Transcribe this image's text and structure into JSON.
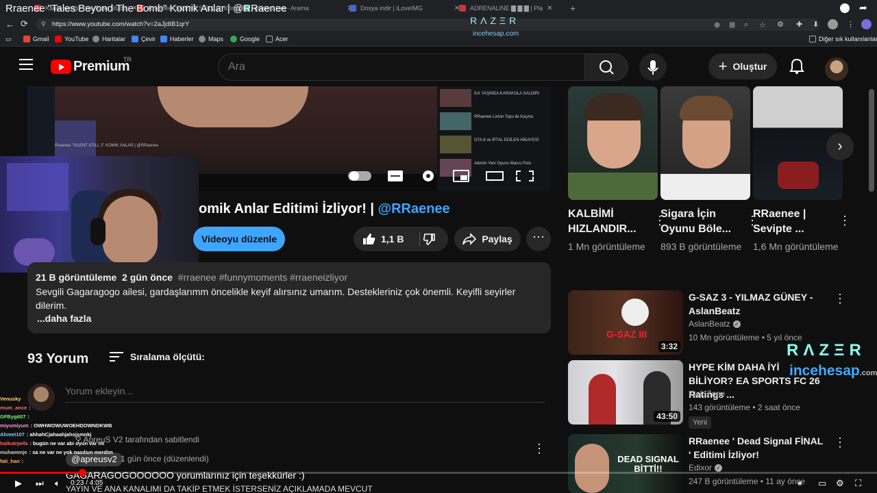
{
  "window": {
    "title": "Rraenee \"Tales Beyond The Bomb\" Komik Anlar | @RRaenee"
  },
  "tabs": [
    {
      "label": "Kanal içeriği - YouTube Studio"
    },
    {
      "label": "Rraenee \"SILENT STILL 2\" Komik"
    },
    {
      "label": "görüntü net - Arama"
    },
    {
      "label": "Dosya indir | iLoveIMG"
    },
    {
      "label": "ADRENALINE ▇ ▇ ▇ | Pla"
    }
  ],
  "address": {
    "url": "https://www.youtube.com/watch?v=2aJjdIB1qrY"
  },
  "bookmarks": [
    {
      "label": "Gmail",
      "color": "#ea4335"
    },
    {
      "label": "YouTube",
      "color": "#ff0000"
    },
    {
      "label": "Haritalar",
      "color": "#888888"
    },
    {
      "label": "Çevir",
      "color": "#4285f4"
    },
    {
      "label": "Haberler",
      "color": "#4285f4"
    },
    {
      "label": "Maps",
      "color": "#888888"
    },
    {
      "label": "Google",
      "color": "#34a853"
    },
    {
      "label": "Acer",
      "color": "#888888"
    }
  ],
  "bookmarks_other": "Diğer sık kullanılanlar",
  "header": {
    "logo_text": "Premium",
    "logo_region": "TR",
    "search_placeholder": "Ara",
    "create_label": "Oluştur"
  },
  "embedded_player": {
    "razer": "RΛZΞR",
    "incehesap": "incehesap.com",
    "caption": "Rraenee \"SILENT STILL 2\" KOMİK ANLAR | @RRaenee",
    "side_items": [
      "İLK YAŞINDA KARAKOLA SALDIRI",
      "RRaenee Linton Topu ile Kaçma",
      "GTA 6 ve İPTAL EDİLEN HİKAYESİ",
      "Adenin Yeni Oyunu Marco Polo"
    ]
  },
  "video": {
    "title_text": "omik Anlar Editimi İzliyor! | ",
    "title_handle": "@RRaenee",
    "edit_label": "Videoyu düzenle",
    "like_count": "1,1 B",
    "share_label": "Paylaş"
  },
  "description": {
    "views": "21 B görüntüleme",
    "date": "2 gün önce",
    "tags": "#rraenee #funnymoments #rraeneizliyor",
    "body": "Sevgili Gagaragogo ailesi, gardaşlarımm öncelikle keyif alırsınız umarım. Destekleriniz çok önemli. Keyifli seyirler dilerim.",
    "more": "...daha fazla"
  },
  "comments": {
    "count": "93 Yorum",
    "sort_label": "Sıralama ölçütü:",
    "add_placeholder": "Yorum ekleyin...",
    "pinned_by": "ApreuS V2 tarafından sabitlendi",
    "author": "@apreusv2",
    "time": "1 gün önce (düzenlendi)",
    "text": "GAGARAGOGOOOOOO yorumlarınız için teşekkürler :)",
    "text2": "YAYIN VE ANA KANALIMI DA TAKİP ETMEK İSTERSENİZ AÇIKLAMADA MEVCUT"
  },
  "chat": [
    {
      "user": "Venusky",
      "msg": "",
      "color": "#ffd27a"
    },
    {
      "user": "mum_ance",
      "msg": ":",
      "color": "#ff6b6b"
    },
    {
      "user": "GFBygit07",
      "msg": ":",
      "color": "#7cf57c"
    },
    {
      "user": "miyumiyum",
      "msg": ": OWHWOWUWOEHDOWNDKWB",
      "color": "#ff9bd6"
    },
    {
      "user": "Ahmet107",
      "msg": ": ahhahCjahaahjahsjsmnkj",
      "color": "#7fd4ff"
    },
    {
      "user": "haikutrpefa",
      "msg": ": bugün ne var abi oyun var mı",
      "color": "#ff6b6b"
    },
    {
      "user": "muhammje",
      "msg": ": sa ne var ne yok nasılsın merdim",
      "color": "#cfcfcf"
    },
    {
      "user": "fati_han",
      "msg": ":",
      "color": "#ffb36b"
    }
  ],
  "shorts": [
    {
      "title": "KALBİMİ HIZLANDIR...",
      "views": "1 Mn görüntüleme"
    },
    {
      "title": "Sigara İçin Oyunu Böle...",
      "views": "893 B görüntüleme"
    },
    {
      "title": "RRaenee | Sevipte ...",
      "views": "1,6 Mn görüntüleme"
    }
  ],
  "related": [
    {
      "title": "G-SAZ 3 - YILMAZ GÜNEY - AslanBeatz",
      "channel": "AslanBeatz",
      "verified": true,
      "meta": "10 Mn görüntüleme • 5 yıl önce",
      "duration": "3:32",
      "badge": "",
      "thumb_text": "G-SAZ III"
    },
    {
      "title": "HYPE KİM DAHA İYİ BİLİYOR? EA SPORTS FC 26 Ratings ...",
      "channel": "Kick Zone",
      "verified": false,
      "meta": "143 görüntüleme • 2 saat önce",
      "duration": "43:50",
      "badge": "Yeni",
      "thumb_text": ""
    },
    {
      "title": "RRaenee ' Dead Signal FİNAL ' Editimi İzliyor!",
      "channel": "Edixor",
      "verified": true,
      "meta": "247 B görüntüleme • 11 ay önce",
      "duration": "",
      "badge": "",
      "thumb_text": "DEAD SIGNAL BİTTİ!!"
    }
  ],
  "overlay": {
    "razer": "RΛZΞR",
    "incehesap": "incehesap",
    "incehesap_suffix": ".com"
  },
  "host_player": {
    "time": "0:23 / 4:05",
    "progress": 0.094
  }
}
